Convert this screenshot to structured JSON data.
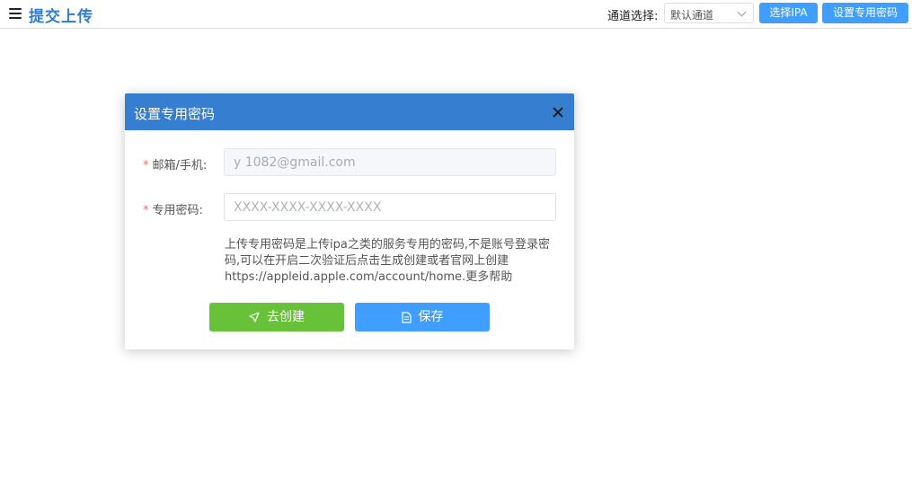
{
  "header": {
    "title": "提交上传",
    "channel_label": "通道选择:",
    "channel_value": "默认通道",
    "select_ipa_button": "选择IPA",
    "set_password_button": "设置专用密码"
  },
  "dialog": {
    "title": "设置专用密码",
    "email_label": "邮箱/手机:",
    "email_value": "y          1082@gmail.com",
    "password_label": "专用密码:",
    "password_placeholder": "XXXX-XXXX-XXXX-XXXX",
    "help_text": "上传专用密码是上传ipa之类的服务专用的密码,不是账号登录密码,可以在开启二次验证后点击生成创建或者官网上创建https://appleid.apple.com/account/home.更多帮助",
    "create_button": "去创建",
    "save_button": "保存",
    "required_mark": "*"
  },
  "colors": {
    "header_title": "#2d7dd2",
    "dialog_header": "#357ed0",
    "primary_button": "#409eff",
    "success_button": "#67c23a",
    "required": "#f56c6c"
  }
}
